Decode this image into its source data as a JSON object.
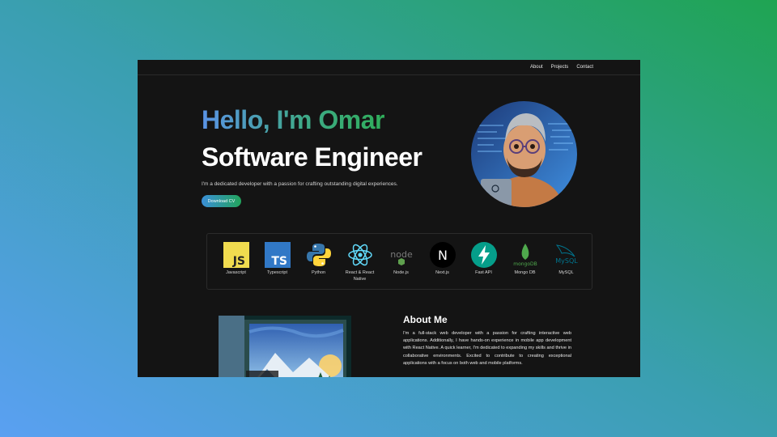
{
  "nav": {
    "links": [
      "About",
      "Projects",
      "Contact"
    ]
  },
  "hero": {
    "greeting": "Hello, I'm Omar",
    "role": "Software Engineer",
    "tagline": "I'm a dedicated developer with a passion for crafting outstanding digital experiences.",
    "cta": "Download CV"
  },
  "skills": [
    {
      "name": "Javascript",
      "icon": "javascript-icon"
    },
    {
      "name": "Typescript",
      "icon": "typescript-icon"
    },
    {
      "name": "Python",
      "icon": "python-icon"
    },
    {
      "name": "React & React Native",
      "icon": "react-icon"
    },
    {
      "name": "Node.js",
      "icon": "nodejs-icon"
    },
    {
      "name": "Next.js",
      "icon": "nextjs-icon"
    },
    {
      "name": "Fast API",
      "icon": "fastapi-icon"
    },
    {
      "name": "Mongo DB",
      "icon": "mongodb-icon"
    },
    {
      "name": "MySQL",
      "icon": "mysql-icon"
    }
  ],
  "logo_text": {
    "js": "JS",
    "ts": "TS",
    "next": "N",
    "node": "node",
    "mongo": "mongoDB",
    "mysql": "MySQL"
  },
  "about": {
    "title": "About Me",
    "text": "I'm a full-stack web developer with a passion for crafting interactive web applications. Additionally, I have hands-on experience in mobile app development with React Native. A quick learner, I'm dedicated to expanding my skills and thrive in collaborative environments. Excited to contribute to creating exceptional applications with a focus on both web and mobile platforms."
  },
  "colors": {
    "background_start": "#5aa0f2",
    "background_end": "#1fa452",
    "page_bg": "#141414",
    "accent_blue": "#3b8fd8",
    "accent_green": "#22a55c"
  }
}
